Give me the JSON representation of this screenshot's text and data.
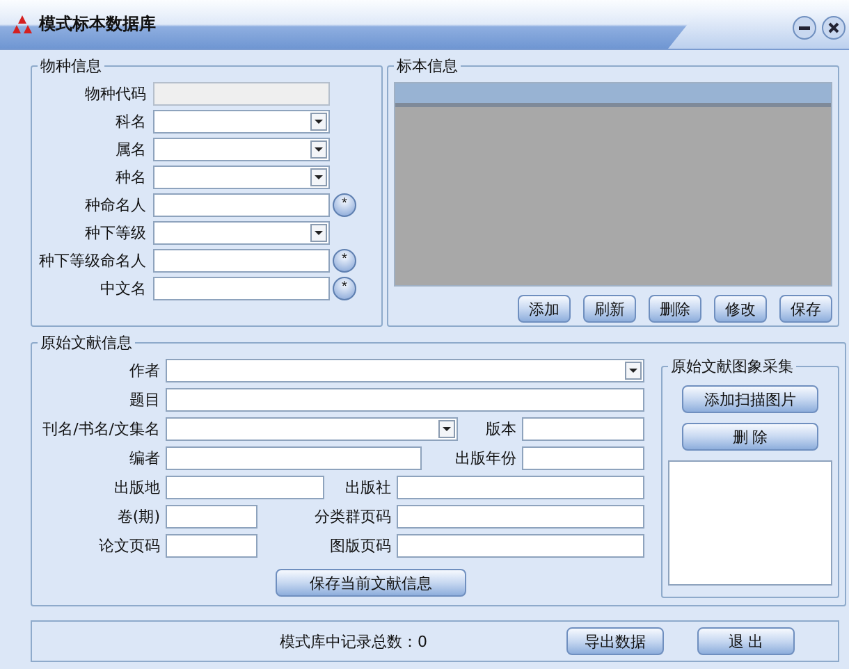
{
  "window": {
    "title": "模式标本数据库"
  },
  "species_info": {
    "title": "物种信息",
    "fields": [
      {
        "label": "物种代码",
        "kind": "readonly"
      },
      {
        "label": "科名",
        "kind": "select"
      },
      {
        "label": "属名",
        "kind": "select"
      },
      {
        "label": "种名",
        "kind": "select"
      },
      {
        "label": "种命名人",
        "kind": "picker",
        "button": "*"
      },
      {
        "label": "种下等级",
        "kind": "select"
      },
      {
        "label": "种下等级命名人",
        "kind": "picker",
        "button": "*"
      },
      {
        "label": "中文名",
        "kind": "picker",
        "button": "*"
      }
    ]
  },
  "specimen_info": {
    "title": "标本信息",
    "buttons": [
      "添加",
      "刷新",
      "删除",
      "修改",
      "保存"
    ]
  },
  "literature_info": {
    "title": "原始文献信息",
    "rows": [
      [
        {
          "label": "作者",
          "kind": "select"
        }
      ],
      [
        {
          "label": "题目",
          "kind": "text"
        }
      ],
      [
        {
          "label": "刊名/书名/文集名",
          "kind": "select"
        },
        {
          "label": "版本",
          "kind": "text"
        }
      ],
      [
        {
          "label": "编者",
          "kind": "text"
        },
        {
          "label": "出版年份",
          "kind": "text"
        }
      ],
      [
        {
          "label": "出版地",
          "kind": "text"
        },
        {
          "label": "出版社",
          "kind": "text"
        }
      ],
      [
        {
          "label": "卷(期)",
          "kind": "text"
        },
        {
          "label": "分类群页码",
          "kind": "text"
        }
      ],
      [
        {
          "label": "论文页码",
          "kind": "text"
        },
        {
          "label": "图版页码",
          "kind": "text"
        }
      ]
    ],
    "save_button": "保存当前文献信息"
  },
  "image_collection": {
    "title": "原始文献图象采集",
    "buttons": [
      "添加扫描图片",
      "删 除"
    ]
  },
  "status": {
    "record_count": "模式库中记录总数：0",
    "buttons": [
      "导出数据",
      "退 出"
    ]
  }
}
